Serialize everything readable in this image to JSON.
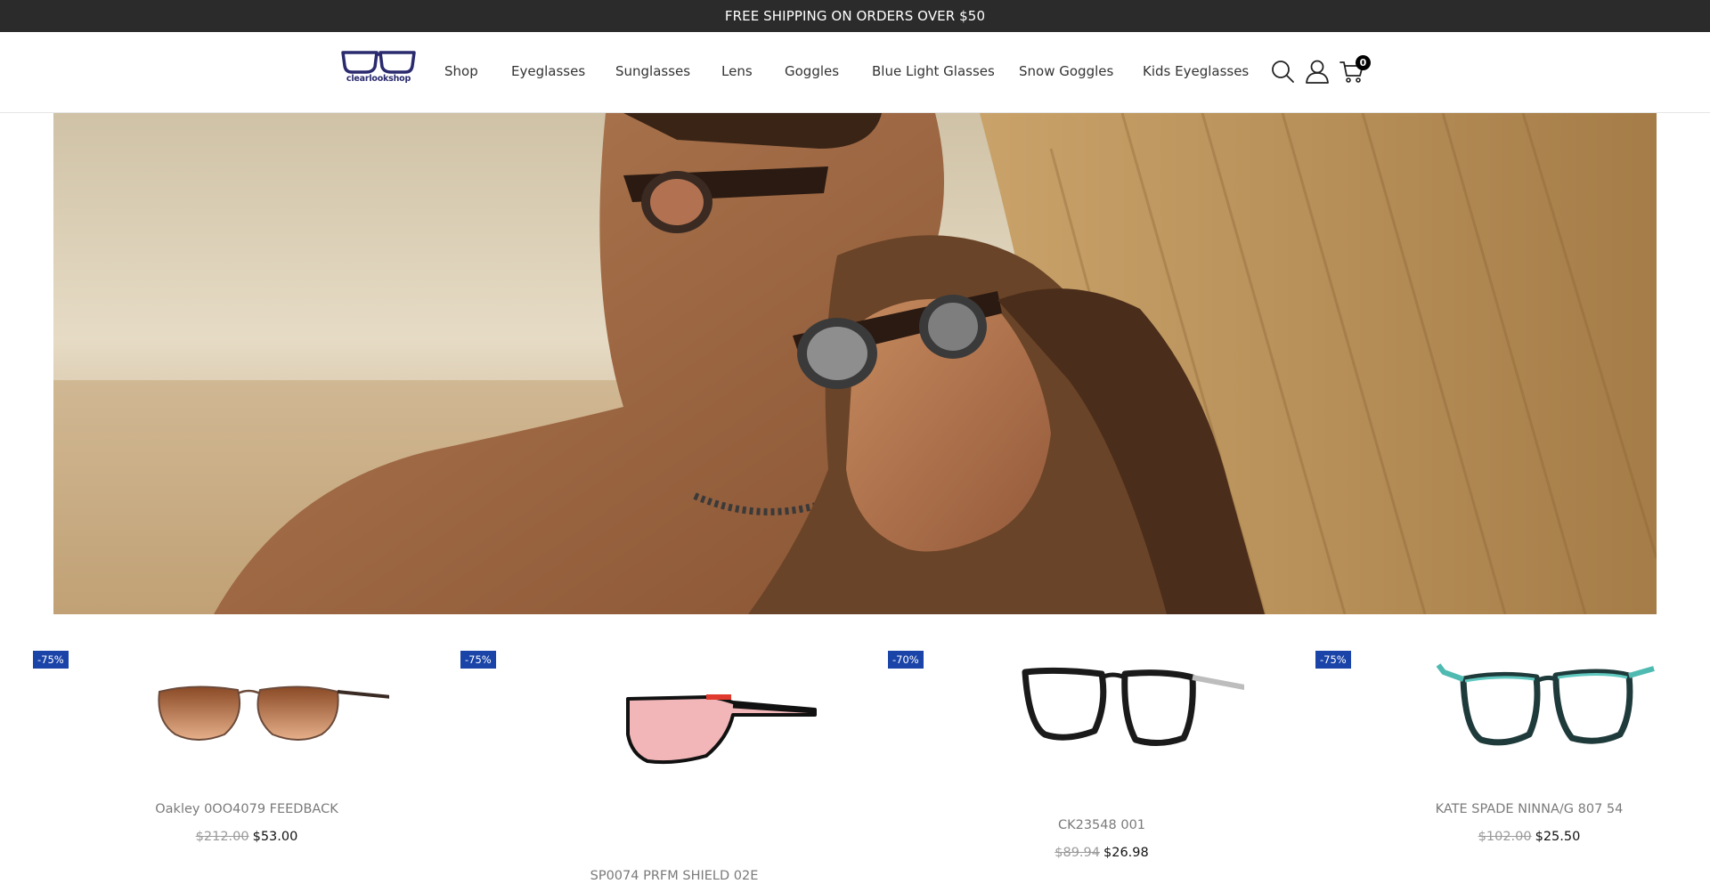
{
  "announcement": {
    "text": "FREE SHIPPING ON ORDERS OVER $50"
  },
  "brand": {
    "name": "clearlookshop",
    "accent": "#2a2a6e"
  },
  "nav": {
    "items": [
      {
        "label": "Shop"
      },
      {
        "label": "Eyeglasses"
      },
      {
        "label": "Sunglasses"
      },
      {
        "label": "Lens"
      },
      {
        "label": "Goggles"
      },
      {
        "label": "Blue Light Glasses"
      },
      {
        "label": "Snow Goggles"
      },
      {
        "label": "Kids Eyeglasses"
      }
    ]
  },
  "header_icons": {
    "search": "search-icon",
    "account": "user-icon",
    "cart": "cart-icon",
    "cart_count": "0"
  },
  "hero": {
    "image": "couple wearing sunglasses on beach"
  },
  "products": [
    {
      "discount": "-75%",
      "name": "Oakley 0OO4079 FEEDBACK",
      "old_price": "$212.00",
      "price": "$53.00"
    },
    {
      "discount": "-75%",
      "name": "SP0074 PRFM SHIELD 02E",
      "old_price": "",
      "price": ""
    },
    {
      "discount": "-70%",
      "name": "CK23548 001",
      "old_price": "$89.94",
      "price": "$26.98"
    },
    {
      "discount": "-75%",
      "name": "KATE SPADE NINNA/G 807 54",
      "old_price": "$102.00",
      "price": "$25.50"
    }
  ],
  "colors": {
    "announcement_bg": "#2b2b2b",
    "badge_bg": "#1a44a8"
  }
}
